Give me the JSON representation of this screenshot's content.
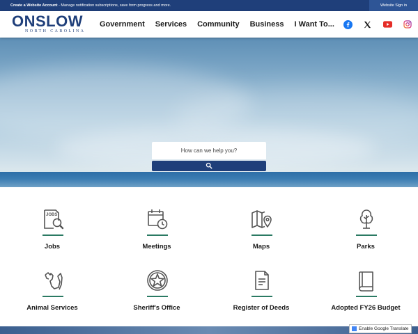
{
  "topbar": {
    "account_link": "Create a Website Account",
    "account_desc": " - Manage notification subscriptions, save form progress and more.",
    "signin_label": "Website Sign in"
  },
  "logo": {
    "word": "ONSLOW",
    "sub": "NORTH CAROLINA"
  },
  "nav": {
    "items": [
      {
        "label": "Government"
      },
      {
        "label": "Services"
      },
      {
        "label": "Community"
      },
      {
        "label": "Business"
      },
      {
        "label": "I Want To..."
      }
    ]
  },
  "social": [
    {
      "icon": "facebook-icon",
      "color": "#1877f2"
    },
    {
      "icon": "x-icon",
      "color": "#111111"
    },
    {
      "icon": "youtube-icon",
      "color": "#e52d27"
    },
    {
      "icon": "instagram-icon",
      "color": "#d62976"
    }
  ],
  "search": {
    "placeholder": "How can we help you?"
  },
  "quick_links": [
    {
      "label": "Jobs",
      "icon": "jobs-icon"
    },
    {
      "label": "Meetings",
      "icon": "calendar-clock-icon"
    },
    {
      "label": "Maps",
      "icon": "map-icon"
    },
    {
      "label": "Parks",
      "icon": "tree-icon"
    },
    {
      "label": "Animal Services",
      "icon": "animal-icon"
    },
    {
      "label": "Sheriff's Office",
      "icon": "sheriff-star-icon"
    },
    {
      "label": "Register of Deeds",
      "icon": "document-icon"
    },
    {
      "label": "Adopted FY26 Budget",
      "icon": "book-icon"
    }
  ],
  "translate": {
    "label": "Enable Google Translate"
  },
  "colors": {
    "brand": "#1f3f7a",
    "accent": "#2b7a63"
  }
}
